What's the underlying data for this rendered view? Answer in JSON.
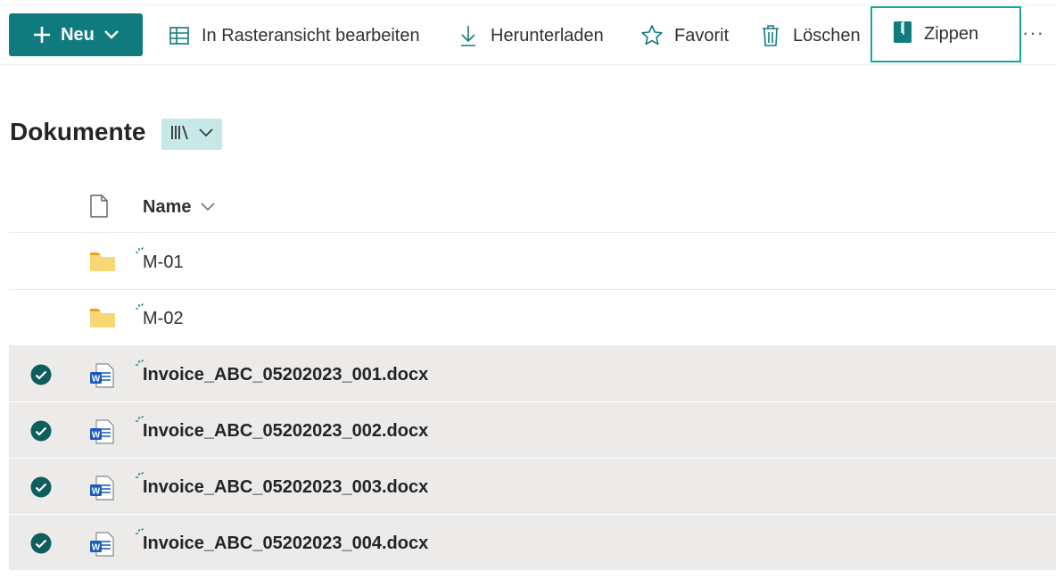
{
  "toolbar": {
    "new_label": "Neu",
    "grid_label": "In Rasteransicht bearbeiten",
    "download_label": "Herunterladen",
    "favorite_label": "Favorit",
    "delete_label": "Löschen",
    "zip_label": "Zippen",
    "more_label": "···"
  },
  "library": {
    "title": "Dokumente"
  },
  "list": {
    "header_name": "Name",
    "items": [
      {
        "name": "M-01",
        "type": "folder",
        "selected": false
      },
      {
        "name": "M-02",
        "type": "folder",
        "selected": false
      },
      {
        "name": "Invoice_ABC_05202023_001.docx",
        "type": "word",
        "selected": true
      },
      {
        "name": "Invoice_ABC_05202023_002.docx",
        "type": "word",
        "selected": true
      },
      {
        "name": "Invoice_ABC_05202023_003.docx",
        "type": "word",
        "selected": true
      },
      {
        "name": "Invoice_ABC_05202023_004.docx",
        "type": "word",
        "selected": true
      }
    ]
  },
  "colors": {
    "accent": "#0f7b7f",
    "zip_border": "#19a69a",
    "selected_row": "#edebe9",
    "folder": "#f8d775"
  },
  "icons": [
    "plus-icon",
    "chevron-down-icon",
    "grid-icon",
    "download-icon",
    "star-icon",
    "trash-icon",
    "zip-icon",
    "library-view-icon",
    "file-icon",
    "folder-icon",
    "word-icon",
    "check-circle-icon",
    "new-sparkle-icon"
  ]
}
